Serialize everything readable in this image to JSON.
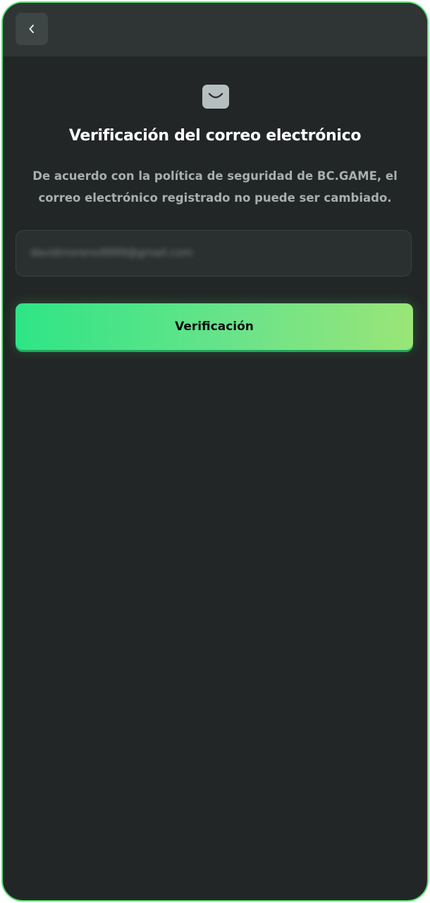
{
  "header": {
    "back_icon": "chevron-left-icon"
  },
  "content": {
    "icon": "envelope-icon",
    "title": "Verificación del correo electrónico",
    "description": "De acuerdo con la política de seguridad de BC.GAME, el correo electrónico registrado no puede ser cambiado.",
    "email_value": "davidmoreno9999@gmail.com",
    "verify_button": "Verificación"
  },
  "colors": {
    "background": "#232626",
    "header": "#2f3434",
    "accent_start": "#2ee585",
    "accent_end": "#9ae577",
    "frame_border": "#5ee07a"
  }
}
